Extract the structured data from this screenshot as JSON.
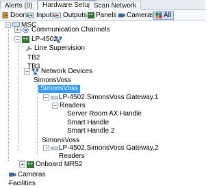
{
  "tabs": [
    {
      "label": "Alerts (0)"
    },
    {
      "label": "Hardware Setup",
      "active": true
    },
    {
      "label": "Scan Network"
    }
  ],
  "toolbar": [
    {
      "label": "Doors",
      "icon": "door-icon"
    },
    {
      "label": "Inputs",
      "icon": "input-icon"
    },
    {
      "label": "Outputs",
      "icon": "output-icon"
    },
    {
      "label": "Panels",
      "icon": "panel-icon"
    },
    {
      "label": "Cameras",
      "icon": "camera-icon"
    },
    {
      "label": "All",
      "icon": "all-icon",
      "active": true
    }
  ],
  "tree": {
    "msc": "MSC",
    "comm_channels": "Communication Channels",
    "lp4502": "LP-4502",
    "line_supervision": "Line Supervision",
    "tb2": "TB2",
    "tb3": "TB3",
    "network_devices": "Network Devices",
    "sv1": "SimonsVoss",
    "sv1_sel": "SimonsVoss",
    "gateway1": "LP-4502.SimonsVoss Gateway.1",
    "readers1": "Readers",
    "reader_a": "Server Room AX Handle",
    "reader_b": "Smart Handle",
    "reader_c": "Smart Handle 2",
    "sv2": "SimonsVoss",
    "gateway2": "LP-4502.SimonsVoss Gateway.2",
    "readers2": "Readers",
    "onboard": "Onboard MR52",
    "cameras": "Cameras",
    "facilities": "Facilities"
  }
}
